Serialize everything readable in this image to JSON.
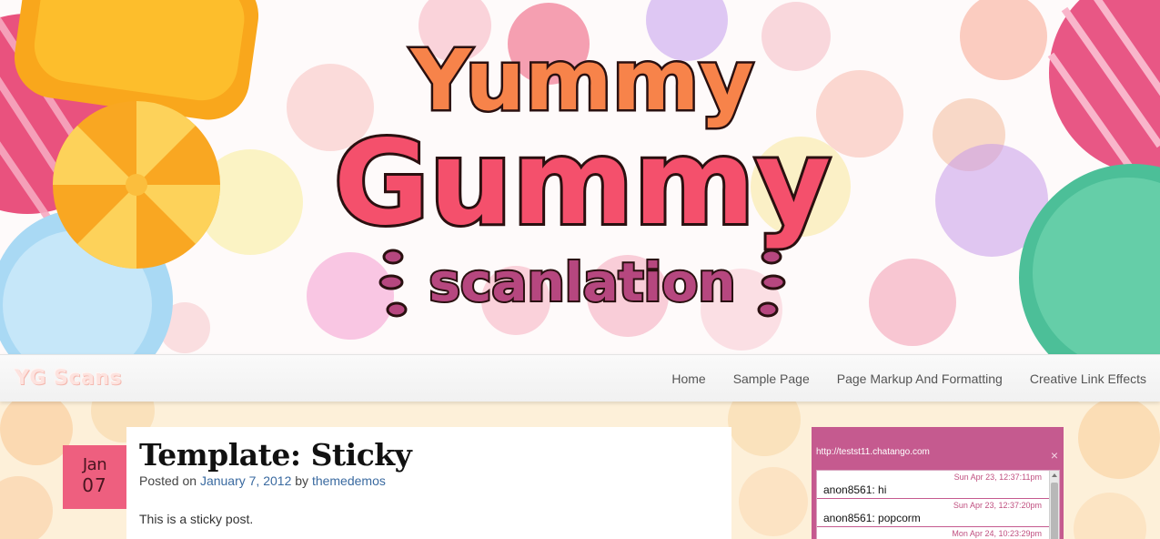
{
  "banner": {
    "logo_line1": "Yummy",
    "logo_line2": "Gummy",
    "logo_line3": "scanlation"
  },
  "nav": {
    "site_title": "YG Scans",
    "items": [
      {
        "label": "Home"
      },
      {
        "label": "Sample Page"
      },
      {
        "label": "Page Markup And Formatting"
      },
      {
        "label": "Creative Link Effects"
      }
    ]
  },
  "post": {
    "date_month": "Jan",
    "date_day": "07",
    "title": "Template: Sticky",
    "posted_on": "Posted on",
    "date_link": "January 7, 2012",
    "by": "by",
    "author": "themedemos",
    "body": "This is a sticky post."
  },
  "chat": {
    "url": "http://testst11.chatango.com",
    "close_glyph": "×",
    "messages": [
      {
        "time": "Sun Apr 23, 12:37:11pm",
        "text": "anon8561: hi"
      },
      {
        "time": "Sun Apr 23, 12:37:20pm",
        "text": "anon8561: popcorm"
      },
      {
        "time": "Mon Apr 24, 10:23:29pm",
        "text": ""
      }
    ]
  },
  "colors": {
    "date_box": "#ee5f7f",
    "chat_bg": "#c55a8f",
    "link": "#3a6aa0",
    "logo_orange": "#f7834a",
    "logo_pink": "#f4506c",
    "logo_purple": "#b6477f"
  }
}
